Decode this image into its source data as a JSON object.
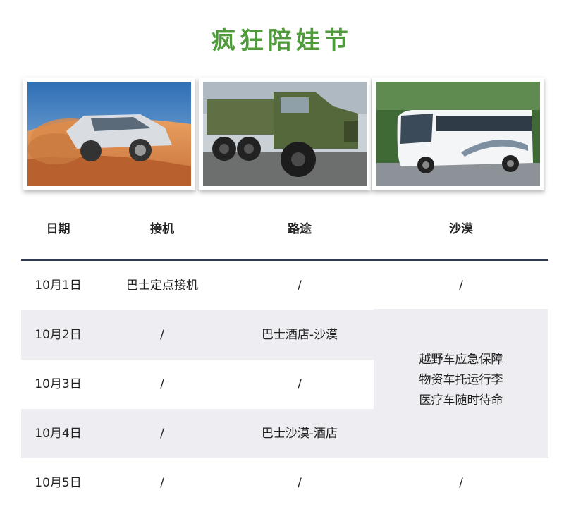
{
  "title": "疯狂陪娃节",
  "photos": [
    {
      "icon": "offroad-suv-in-desert-photo"
    },
    {
      "icon": "military-truck-photo"
    },
    {
      "icon": "white-coach-bus-photo"
    }
  ],
  "table": {
    "headers": [
      "日期",
      "接机",
      "路途",
      "沙漠"
    ],
    "rows": [
      {
        "date": "10月1日",
        "pickup": "巴士定点接机",
        "route": "/",
        "desert": "/"
      },
      {
        "date": "10月2日",
        "pickup": "/",
        "route": "巴士酒店-沙漠"
      },
      {
        "date": "10月3日",
        "pickup": "/",
        "route": "/"
      },
      {
        "date": "10月4日",
        "pickup": "/",
        "route": "巴士沙漠-酒店"
      },
      {
        "date": "10月5日",
        "pickup": "/",
        "route": "/",
        "desert": "/"
      }
    ],
    "desert_merged": [
      "越野车应急保障",
      "物资车托运行李",
      "医疗车随时待命"
    ]
  },
  "colors": {
    "title": "#4f9a3a",
    "row_shade": "#eeeef2",
    "header_rule": "#2e3a4f"
  }
}
